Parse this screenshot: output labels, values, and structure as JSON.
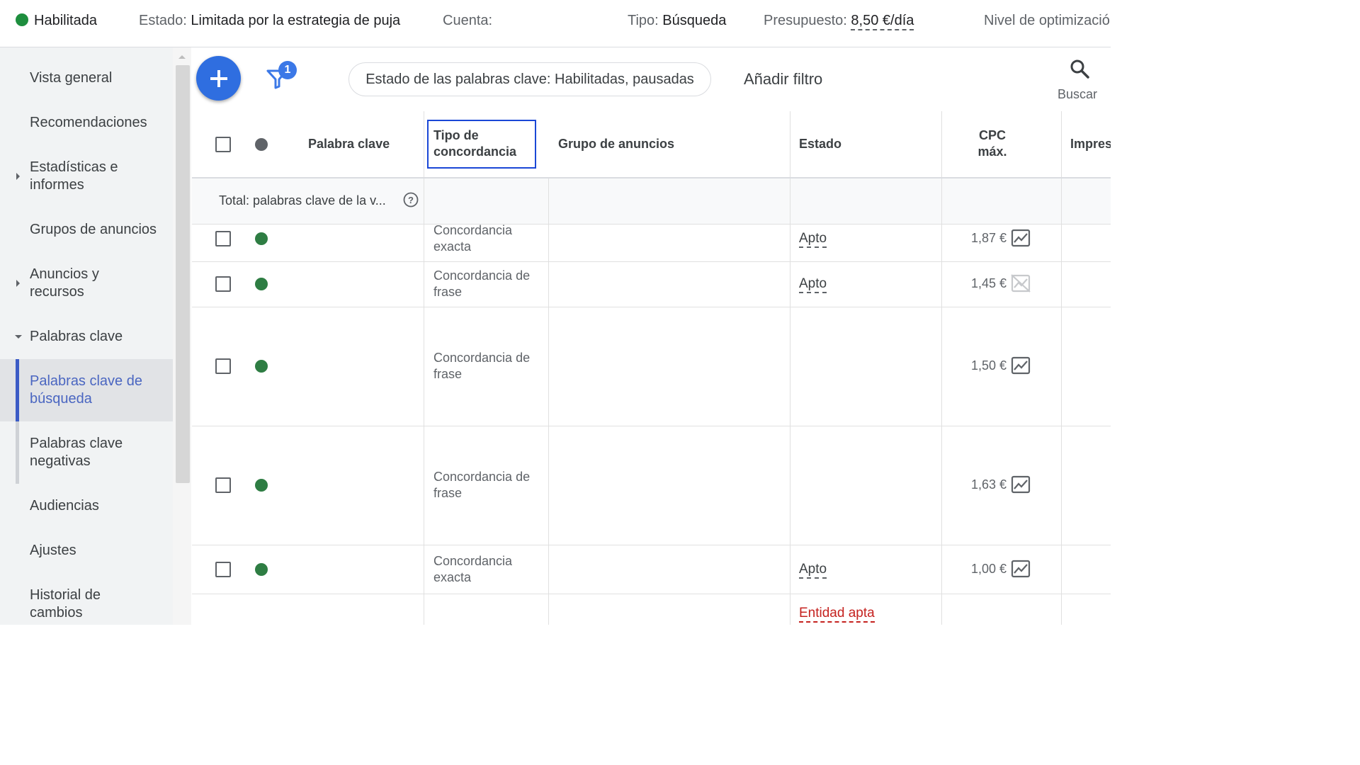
{
  "topbar": {
    "status_value": "Habilitada",
    "estado_label": "Estado:",
    "estado_value": "Limitada por la estrategia de puja",
    "cuenta_label": "Cuenta:",
    "tipo_label": "Tipo:",
    "tipo_value": "Búsqueda",
    "presupuesto_label": "Presupuesto:",
    "presupuesto_value": "8,50 €/día",
    "nivel_label": "Nivel de optimizació"
  },
  "sidebar": {
    "items": [
      {
        "label": "Vista general"
      },
      {
        "label": "Recomendaciones"
      },
      {
        "label": "Estadísticas e informes"
      },
      {
        "label": "Grupos de anuncios"
      },
      {
        "label": "Anuncios y recursos"
      },
      {
        "label": "Palabras clave"
      },
      {
        "label": "Palabras clave de búsqueda"
      },
      {
        "label": "Palabras clave negativas"
      },
      {
        "label": "Audiencias"
      },
      {
        "label": "Ajustes"
      },
      {
        "label": "Historial de cambios"
      }
    ]
  },
  "toolbar": {
    "filter_count": "1",
    "filter_chip": "Estado de las palabras clave: Habilitadas, pausadas",
    "add_filter": "Añadir filtro",
    "search_label": "Buscar"
  },
  "table": {
    "headers": {
      "keyword": "Palabra clave",
      "match_type": "Tipo de concordancia",
      "ad_group": "Grupo de anuncios",
      "status": "Estado",
      "cpc": "CPC máx.",
      "impr": "Impres"
    },
    "total_label": "Total: palabras clave de la v...",
    "rows": [
      {
        "match": "Concordancia exacta",
        "status": "Apto",
        "cpc": "1,87 €",
        "spark": "active"
      },
      {
        "match": "Concordancia de frase",
        "status": "Apto",
        "cpc": "1,45 €",
        "spark": "disabled"
      },
      {
        "match": "Concordancia de frase",
        "status": "",
        "cpc": "1,50 €",
        "spark": "active"
      },
      {
        "match": "Concordancia de frase",
        "status": "",
        "cpc": "1,63 €",
        "spark": "active"
      },
      {
        "match": "Concordancia exacta",
        "status": "Apto",
        "cpc": "1,00 €",
        "spark": "active"
      }
    ],
    "last_row_status": "Entidad apta"
  },
  "colors": {
    "accent": "#2f6ee0",
    "active_nav": "#4a66c1",
    "status_green": "#2e7d43",
    "warning_red": "#c5221f",
    "highlight_border": "#1a47d6"
  },
  "icons": [
    "plus-icon",
    "filter-icon",
    "search-icon",
    "help-icon",
    "sparkline-icon",
    "sparkline-disabled-icon",
    "caret-right-icon",
    "caret-down-icon"
  ]
}
